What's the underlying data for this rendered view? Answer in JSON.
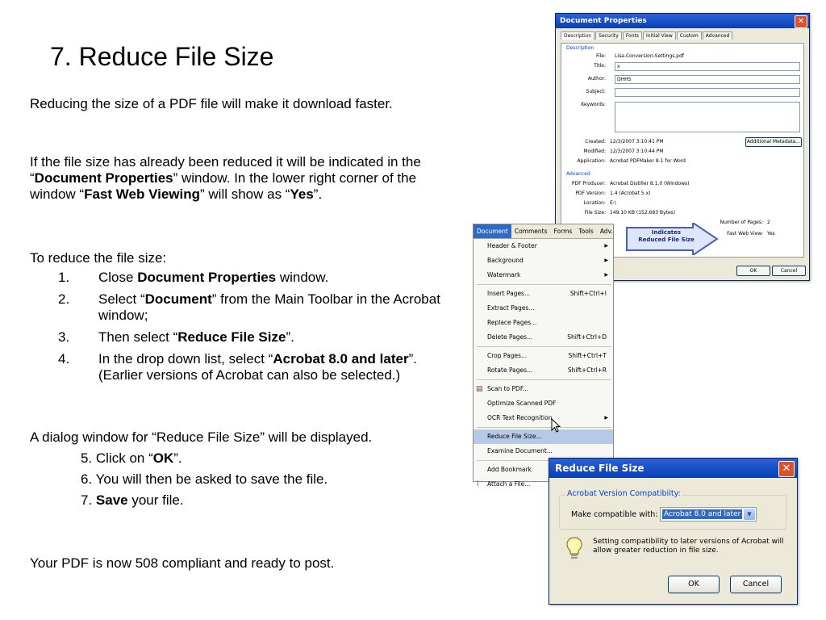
{
  "slide": {
    "title": "7.  Reduce File Size",
    "intro": "Reducing the size of a PDF file will make it download faster.",
    "para2": {
      "t1": "If the file size has already been reduced it will be indicated in the “",
      "b1": "Document Properties",
      "t2": "” window. In the lower right corner of the window “",
      "b2": "Fast Web Viewing",
      "t3": "” will  show as “",
      "b3": "Yes",
      "t4": "”."
    },
    "to_reduce": "To reduce the file size:",
    "steps": [
      {
        "num": "1.",
        "t1": "Close ",
        "b": "Document Properties",
        "t2": " window."
      },
      {
        "num": "2.",
        "t1": "Select “",
        "b": "Document",
        "t2": "” from the Main Toolbar in the Acrobat window;"
      },
      {
        "num": "3.",
        "t1": "Then select “",
        "b": "Reduce File Size",
        "t2": "”."
      },
      {
        "num": "4.",
        "t1": "In the drop down list, select “",
        "b": "Acrobat 8.0 and later",
        "t2": "”. (Earlier versions of Acrobat can also be selected.)"
      }
    ],
    "dialog_note": "A dialog window for “Reduce File Size” will be displayed.",
    "step5": {
      "t1": "5. Click on “",
      "b": "OK",
      "t2": "”."
    },
    "step6": "6. You will then be asked to save the file.",
    "step7": {
      "t1": "7. ",
      "b": "Save",
      "t2": " your file."
    },
    "closing": "Your PDF is now 508 compliant and ready to post."
  },
  "doc_properties": {
    "title": "Document Properties",
    "tabs": [
      "Description",
      "Security",
      "Fonts",
      "Initial View",
      "Custom",
      "Advanced"
    ],
    "section_description": "Description",
    "file_label": "File:",
    "file_value": "Lisa-Conversion-Settings.pdf",
    "title_label": "Title:",
    "title_value": "x",
    "author_label": "Author:",
    "author_value": "DHHS",
    "subject_label": "Subject:",
    "keywords_label": "Keywords:",
    "created_label": "Created:",
    "created_value": "12/3/2007 3:10:41 PM",
    "modified_label": "Modified:",
    "modified_value": "12/3/2007 3:10:44 PM",
    "application_label": "Application:",
    "application_value": "Acrobat PDFMaker 8.1 for Word",
    "additional_metadata": "Additional Metadata...",
    "section_advanced": "Advanced",
    "producer_label": "PDF Producer:",
    "producer_value": "Acrobat Distiller 8.1.0 (Windows)",
    "version_label": "PDF Version:",
    "version_value": "1.4 (Acrobat 5.x)",
    "location_label": "Location:",
    "location_value": "E:\\",
    "filesize_label": "File Size:",
    "filesize_value": "149.10 KB (152,683 Bytes)",
    "pages_label": "Number of Pages:",
    "pages_value": "2",
    "fastweb_label": "Fast Web View:",
    "fastweb_value": "Yes",
    "callout": "Indicates Reduced File Size",
    "ok": "OK",
    "cancel": "Cancel"
  },
  "menu": {
    "bar": [
      "Document",
      "Comments",
      "Forms",
      "Tools",
      "Adv."
    ],
    "items": [
      {
        "label": "Header & Footer",
        "shortcut": "",
        "arrow": "▶"
      },
      {
        "label": "Background",
        "shortcut": "",
        "arrow": "▶"
      },
      {
        "label": "Watermark",
        "shortcut": "",
        "arrow": "▶"
      },
      {
        "label": "Insert Pages...",
        "shortcut": "Shift+Ctrl+I",
        "arrow": ""
      },
      {
        "label": "Extract Pages...",
        "shortcut": "",
        "arrow": ""
      },
      {
        "label": "Replace Pages...",
        "shortcut": "",
        "arrow": ""
      },
      {
        "label": "Delete Pages...",
        "shortcut": "Shift+Ctrl+D",
        "arrow": ""
      },
      {
        "label": "Crop Pages...",
        "shortcut": "Shift+Ctrl+T",
        "arrow": ""
      },
      {
        "label": "Rotate Pages...",
        "shortcut": "Shift+Ctrl+R",
        "arrow": ""
      },
      {
        "label": "Scan to PDF...",
        "shortcut": "",
        "arrow": ""
      },
      {
        "label": "Optimize Scanned PDF",
        "shortcut": "",
        "arrow": ""
      },
      {
        "label": "OCR Text Recognition",
        "shortcut": "",
        "arrow": "▶"
      },
      {
        "label": "Reduce File Size...",
        "shortcut": "",
        "arrow": ""
      },
      {
        "label": "Examine Document...",
        "shortcut": "",
        "arrow": ""
      },
      {
        "label": "Add Bookmark",
        "shortcut": "",
        "arrow": ""
      },
      {
        "label": "Attach a File...",
        "shortcut": "",
        "arrow": ""
      }
    ]
  },
  "reduce_dialog": {
    "title": "Reduce File Size",
    "group_label": "Acrobat Version Compatibilty:",
    "make_compatible": "Make compatible with:",
    "selected": "Acrobat 8.0 and later",
    "hint": "Setting compatibility to later versions of Acrobat will allow greater reduction in file size.",
    "ok": "OK",
    "cancel": "Cancel"
  }
}
